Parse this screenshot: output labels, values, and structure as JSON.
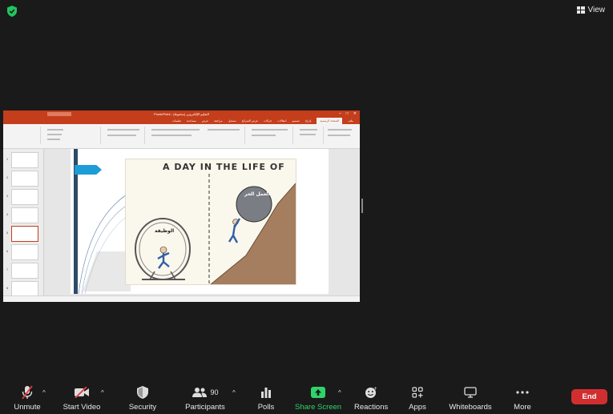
{
  "topbar": {
    "view_label": "View"
  },
  "ppt": {
    "app_title": "PowerPoint - (محفوظ) التعليم الإلكتروني",
    "tabs": [
      "ملف",
      "الصفحة الرئيسية",
      "إدراج",
      "تصميم",
      "انتقالات",
      "حركات",
      "عرض الشرائح",
      "تسجيل",
      "مراجعة",
      "عرض",
      "مساعدة",
      "تعليمات"
    ],
    "active_tab": "الصفحة الرئيسية",
    "slide_numbers": [
      "1",
      "2",
      "3",
      "4",
      "5",
      "6",
      "7",
      "8"
    ],
    "slide_title": "A DAY IN THE LIFE OF",
    "left_label": "الوظيفة",
    "right_label": "العمل الحر"
  },
  "toolbar": {
    "unmute": "Unmute",
    "start_video": "Start Video",
    "security": "Security",
    "participants": "Participants",
    "participants_count": "90",
    "polls": "Polls",
    "share_screen": "Share Screen",
    "reactions": "Reactions",
    "apps": "Apps",
    "whiteboards": "Whiteboards",
    "more": "More",
    "end": "End"
  },
  "colors": {
    "share_green": "#2fd36a",
    "end_red": "#d12f2f",
    "ppt_accent": "#c43e1c"
  }
}
